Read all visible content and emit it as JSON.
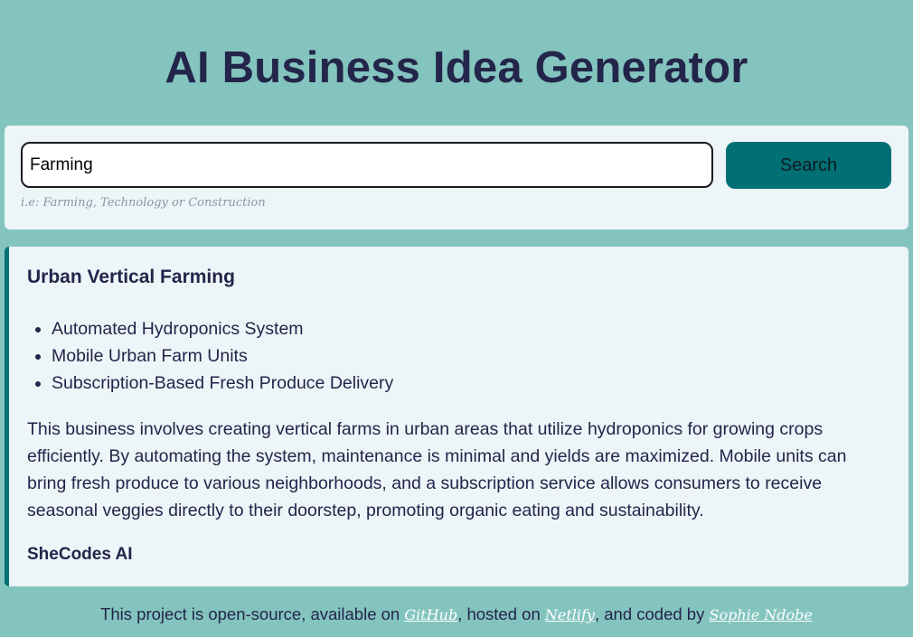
{
  "header": {
    "title": "AI Business Idea Generator"
  },
  "search": {
    "value": "Farming",
    "button_label": "Search",
    "hint": "i.e: Farming, Technology or Construction"
  },
  "result": {
    "title": "Urban Vertical Farming",
    "features": [
      "Automated Hydroponics System",
      "Mobile Urban Farm Units",
      "Subscription-Based Fresh Produce Delivery"
    ],
    "description": "This business involves creating vertical farms in urban areas that utilize hydroponics for growing crops efficiently. By automating the system, maintenance is minimal and yields are maximized. Mobile units can bring fresh produce to various neighborhoods, and a subscription service allows consumers to receive seasonal veggies directly to their doorstep, promoting organic eating and sustainability.",
    "signature": "SheCodes AI"
  },
  "footer": {
    "text_1": "This project is open-source, available on ",
    "github_label": "GitHub",
    "text_2": ", hosted on ",
    "netlify_label": "Netlify",
    "text_3": ", and coded by ",
    "author_label": "Sophie Ndobe"
  },
  "colors": {
    "background": "#84c4bf",
    "panel": "#edf5f8",
    "accent": "#007075",
    "text": "#23254a"
  }
}
